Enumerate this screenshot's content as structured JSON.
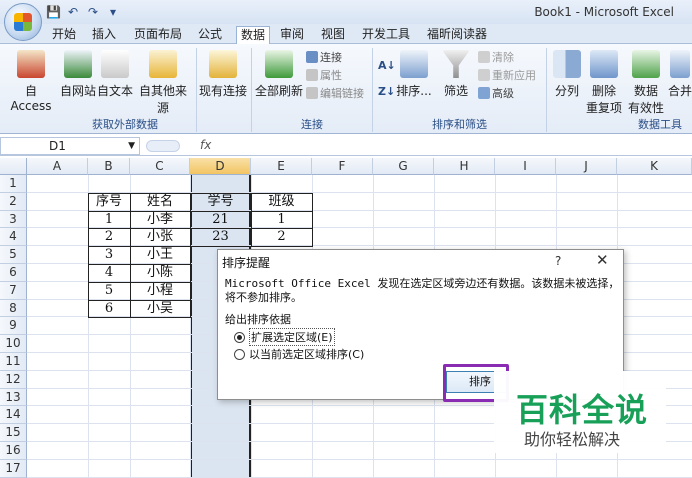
{
  "window": {
    "title": "Book1 - Microsoft Excel"
  },
  "tabs": [
    "开始",
    "插入",
    "页面布局",
    "公式",
    "数据",
    "审阅",
    "视图",
    "开发工具",
    "福昕阅读器"
  ],
  "active_tab": "数据",
  "ribbon": {
    "groups": {
      "external": {
        "caption": "获取外部数据",
        "buttons": {
          "access": "自 Access",
          "web": "自网站",
          "text": "自文本",
          "other": "自其他来源",
          "existing": "现有连接"
        }
      },
      "connections": {
        "caption": "连接",
        "refresh_all": "全部刷新",
        "connections": "连接",
        "properties": "属性",
        "edit_links": "编辑链接"
      },
      "sort_filter": {
        "caption": "排序和筛选",
        "sort": "排序...",
        "filter": "筛选",
        "clear": "清除",
        "reapply": "重新应用",
        "advanced": "高级"
      },
      "data_tools": {
        "caption": "数据工具",
        "text_to_columns": "分列",
        "remove_duplicates_1": "删除",
        "remove_duplicates_2": "重复项",
        "validation_1": "数据",
        "validation_2": "有效性",
        "consolidate": "合并"
      }
    }
  },
  "formula_bar": {
    "name_box": "D1",
    "fx": "fx"
  },
  "columns": [
    "A",
    "B",
    "C",
    "D",
    "E",
    "F",
    "G",
    "H",
    "I",
    "J",
    "K"
  ],
  "rows": [
    "1",
    "2",
    "3",
    "4",
    "5",
    "6",
    "7",
    "8",
    "9",
    "10",
    "11",
    "12",
    "13",
    "14",
    "15",
    "16",
    "17"
  ],
  "table": {
    "headers": {
      "B": "序号",
      "C": "姓名",
      "D": "学号",
      "E": "班级"
    },
    "rows": [
      {
        "B": "1",
        "C": "小李",
        "D": "21",
        "E": "1"
      },
      {
        "B": "2",
        "C": "小张",
        "D": "23",
        "E": "2"
      },
      {
        "B": "3",
        "C": "小王",
        "D": "",
        "E": ""
      },
      {
        "B": "4",
        "C": "小陈",
        "D": "",
        "E": ""
      },
      {
        "B": "5",
        "C": "小程",
        "D": "",
        "E": ""
      },
      {
        "B": "6",
        "C": "小吴",
        "D": "",
        "E": ""
      }
    ]
  },
  "dialog": {
    "title": "排序提醒",
    "help": "?",
    "close": "✕",
    "message": "Microsoft Office Excel 发现在选定区域旁边还有数据。该数据未被选择，将不参加排序。",
    "section": "给出排序依据",
    "option_expand": "扩展选定区域(E)",
    "option_current": "以当前选定区域排序(C)",
    "expand_selected": true,
    "sort_button": "排序"
  },
  "watermark": {
    "main": "百科全说",
    "sub": "助你轻松解决"
  },
  "colors": {
    "accent": "#2a4f86",
    "highlight": "#8a2bb4",
    "watermark": "#18a058"
  }
}
